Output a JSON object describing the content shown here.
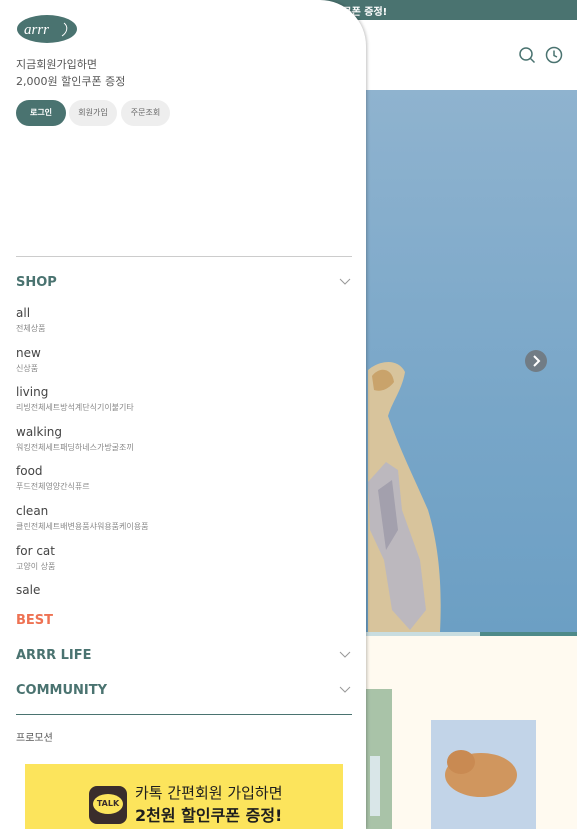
{
  "background": {
    "topbar_text": "할인쿠폰 증정!",
    "header_icons": [
      "search-icon",
      "recent-clock-icon"
    ],
    "hero_progress": 0.17
  },
  "drawer": {
    "logo_text": "arrr",
    "promo_line1": "지금회원가입하면",
    "promo_line2": "2,000원 할인쿠폰 증정",
    "buttons": {
      "login": "로그인",
      "join": "회원가입",
      "order": "주문조회"
    },
    "sections": {
      "shop": "SHOP",
      "best": "BEST",
      "arrr_life": "ARRR LIFE",
      "community": "COMMUNITY"
    },
    "categories": [
      {
        "name": "all",
        "sub": "전체상품"
      },
      {
        "name": "new",
        "sub": "신상품"
      },
      {
        "name": "living",
        "sub": "리빙전체세트방석계단식기이불기타"
      },
      {
        "name": "walking",
        "sub": "워킹전체세트패딩하네스가방굴조끼"
      },
      {
        "name": "food",
        "sub": "푸드전체영양간식퓨르"
      },
      {
        "name": "clean",
        "sub": "클린전체세트배변용품샤워용품케이용품"
      },
      {
        "name": "for cat",
        "sub": "고양이 상품"
      },
      {
        "name": "sale",
        "sub": ""
      }
    ],
    "promotion_link": "프로모션",
    "kakao_banner": {
      "badge": "TALK",
      "line1": "카톡 간편회원 가입하면",
      "line2": "2천원 할인쿠폰 증정!"
    }
  },
  "colors": {
    "accent": "#4a7370",
    "best": "#ee7253",
    "banner": "#fce45c"
  }
}
